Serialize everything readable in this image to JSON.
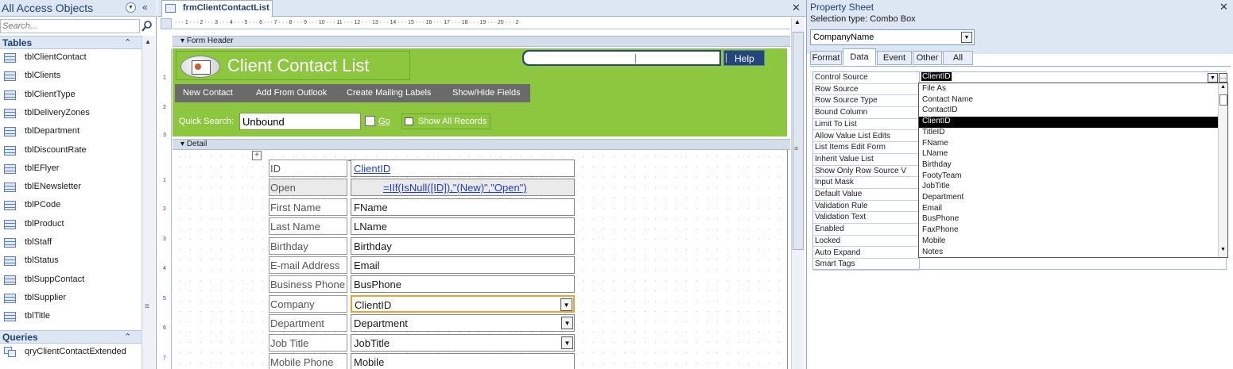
{
  "nav": {
    "title": "All Access Objects",
    "search_placeholder": "Search...",
    "groups": {
      "tables": "Tables",
      "queries": "Queries"
    },
    "tables": [
      "tblClientContact",
      "tblClients",
      "tblClientType",
      "tblDeliveryZones",
      "tblDepartment",
      "tblDiscountRate",
      "tblEFlyer",
      "tblENewsletter",
      "tblPCode",
      "tblProduct",
      "tblStaff",
      "tblStatus",
      "tblSuppContact",
      "tblSupplier",
      "tblTitle"
    ],
    "queries": [
      "qryClientContactExtended"
    ]
  },
  "document": {
    "tab_title": "frmClientContactList",
    "ruler_text": "· · · 1 · · · 2 · · · 3 · · · 4 · · · 5 · · · 6 · · · 7 · · · 8 · · · 9 · · · 10 · · · 11 · · · 12 · · · 13 · · · 14 · · · 15 · · · 16 · · · 17 · · · 18 · · · 19 · · · 20 · · · 2",
    "form_header_label": "Form Header",
    "detail_label": "Detail",
    "vruler_header": [
      "1",
      "2",
      "3"
    ],
    "vruler_detail": [
      "1",
      "2",
      "3",
      "4",
      "5",
      "6",
      "7"
    ]
  },
  "form_header": {
    "title": "Client Contact List",
    "help_label": "Help",
    "buttons": [
      "New Contact",
      "Add From Outlook",
      "Create Mailing Labels",
      "Show/Hide Fields"
    ],
    "quick_search_label": "Quick Search:",
    "quick_search_value": "Unbound",
    "go_label": "Go",
    "show_all_label": "Show All Records"
  },
  "detail": {
    "rows": [
      {
        "label": "ID",
        "field": "ClientID"
      },
      {
        "label": "Open",
        "field": "=IIf(IsNull([ID]),\"(New)\",\"Open\")"
      },
      {
        "label": "First Name",
        "field": "FName"
      },
      {
        "label": "Last Name",
        "field": "LName"
      },
      {
        "label": "Birthday",
        "field": "Birthday"
      },
      {
        "label": "E-mail Address",
        "field": "Email"
      },
      {
        "label": "Business Phone",
        "field": "BusPhone"
      },
      {
        "label": "Company",
        "field": "ClientID"
      },
      {
        "label": "Department",
        "field": "Department"
      },
      {
        "label": "Job Title",
        "field": "JobTitle"
      },
      {
        "label": "Mobile Phone",
        "field": "Mobile"
      }
    ]
  },
  "property_sheet": {
    "title": "Property Sheet",
    "selection_type": "Selection type:  Combo Box",
    "object_name": "CompanyName",
    "tabs": [
      "Format",
      "Data",
      "Event",
      "Other",
      "All"
    ],
    "active_tab": "Data",
    "properties": [
      "Control Source",
      "Row Source",
      "Row Source Type",
      "Bound Column",
      "Limit To List",
      "Allow Value List Edits",
      "List Items Edit Form",
      "Inherit Value List",
      "Show Only Row Source V",
      "Input Mask",
      "Default Value",
      "Validation Rule",
      "Validation Text",
      "Enabled",
      "Locked",
      "Auto Expand",
      "Smart Tags"
    ],
    "control_source_value": "ClientID",
    "dropdown_options": [
      "File As",
      "Contact Name",
      "ContactID",
      "ClientID",
      "TitleID",
      "FName",
      "LName",
      "Birthday",
      "FootyTeam",
      "JobTitle",
      "Department",
      "Email",
      "BusPhone",
      "FaxPhone",
      "Mobile",
      "Notes"
    ],
    "selected_option": "ClientID"
  },
  "colors": {
    "header_green": "#8dc63f",
    "button_bar_gray": "#6a6a6a",
    "navy": "#24467a",
    "selection_orange": "#f0a030"
  }
}
